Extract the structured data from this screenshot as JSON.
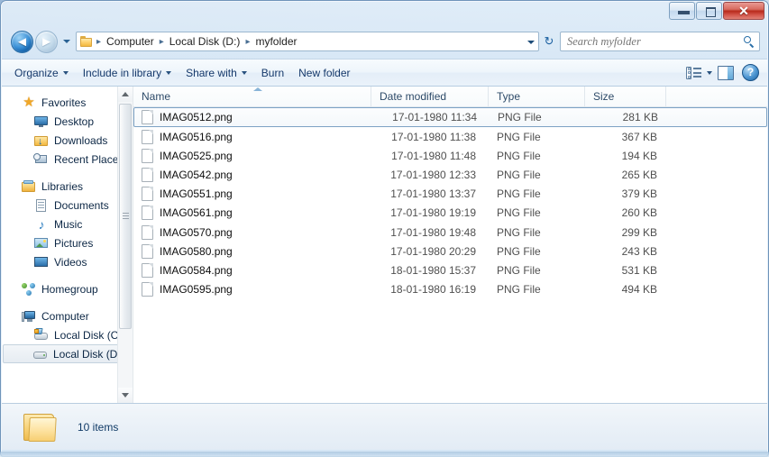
{
  "window": {
    "controls": {
      "minimize_label": "",
      "maximize_label": "",
      "close_label": "✕"
    }
  },
  "address_bar": {
    "back_glyph": "◄",
    "forward_glyph": "►",
    "refresh_glyph": "↻",
    "folder_icon": "folder-icon",
    "crumbs": [
      {
        "label": "Computer"
      },
      {
        "label": "Local Disk (D:)"
      },
      {
        "label": "myfolder"
      }
    ],
    "separator": "▸"
  },
  "search": {
    "placeholder": "Search myfolder",
    "value": ""
  },
  "toolbar": {
    "items": [
      {
        "label": "Organize",
        "has_caret": true
      },
      {
        "label": "Include in library",
        "has_caret": true
      },
      {
        "label": "Share with",
        "has_caret": true
      },
      {
        "label": "Burn",
        "has_caret": false
      },
      {
        "label": "New folder",
        "has_caret": false
      }
    ],
    "help_label": "?"
  },
  "navigation": {
    "groups": [
      {
        "header": {
          "label": "Favorites",
          "icon": "star-icon"
        },
        "items": [
          {
            "label": "Desktop",
            "icon": "desktop-icon"
          },
          {
            "label": "Downloads",
            "icon": "downloads-icon"
          },
          {
            "label": "Recent Places",
            "icon": "recent-places-icon"
          }
        ]
      },
      {
        "header": {
          "label": "Libraries",
          "icon": "libraries-icon"
        },
        "items": [
          {
            "label": "Documents",
            "icon": "documents-icon"
          },
          {
            "label": "Music",
            "icon": "music-icon"
          },
          {
            "label": "Pictures",
            "icon": "pictures-icon"
          },
          {
            "label": "Videos",
            "icon": "videos-icon"
          }
        ]
      },
      {
        "header": {
          "label": "Homegroup",
          "icon": "homegroup-icon"
        },
        "items": []
      },
      {
        "header": {
          "label": "Computer",
          "icon": "computer-icon"
        },
        "items": [
          {
            "label": "Local Disk (C:)",
            "icon": "disk-c-icon",
            "selected": false
          },
          {
            "label": "Local Disk (D:)",
            "icon": "disk-d-icon",
            "selected": true
          }
        ]
      }
    ]
  },
  "file_list": {
    "columns": [
      {
        "key": "name",
        "label": "Name",
        "sorted": "asc"
      },
      {
        "key": "date",
        "label": "Date modified"
      },
      {
        "key": "type",
        "label": "Type"
      },
      {
        "key": "size",
        "label": "Size"
      }
    ],
    "rows": [
      {
        "name": "IMAG0512.png",
        "date": "17-01-1980 11:34",
        "type": "PNG File",
        "size": "281 KB",
        "selected": true
      },
      {
        "name": "IMAG0516.png",
        "date": "17-01-1980 11:38",
        "type": "PNG File",
        "size": "367 KB",
        "selected": false
      },
      {
        "name": "IMAG0525.png",
        "date": "17-01-1980 11:48",
        "type": "PNG File",
        "size": "194 KB",
        "selected": false
      },
      {
        "name": "IMAG0542.png",
        "date": "17-01-1980 12:33",
        "type": "PNG File",
        "size": "265 KB",
        "selected": false
      },
      {
        "name": "IMAG0551.png",
        "date": "17-01-1980 13:37",
        "type": "PNG File",
        "size": "379 KB",
        "selected": false
      },
      {
        "name": "IMAG0561.png",
        "date": "17-01-1980 19:19",
        "type": "PNG File",
        "size": "260 KB",
        "selected": false
      },
      {
        "name": "IMAG0570.png",
        "date": "17-01-1980 19:48",
        "type": "PNG File",
        "size": "299 KB",
        "selected": false
      },
      {
        "name": "IMAG0580.png",
        "date": "17-01-1980 20:29",
        "type": "PNG File",
        "size": "243 KB",
        "selected": false
      },
      {
        "name": "IMAG0584.png",
        "date": "18-01-1980 15:37",
        "type": "PNG File",
        "size": "531 KB",
        "selected": false
      },
      {
        "name": "IMAG0595.png",
        "date": "18-01-1980 16:19",
        "type": "PNG File",
        "size": "494 KB",
        "selected": false
      }
    ]
  },
  "status": {
    "item_count_label": "10 items",
    "folder_icon": "folder-icon"
  },
  "colors": {
    "accent": "#1d5f9e",
    "close_button": "#b82b1c",
    "selection_border": "#7da2c4",
    "text_primary": "#0d0d0d",
    "text_secondary": "#4f4f4f"
  }
}
